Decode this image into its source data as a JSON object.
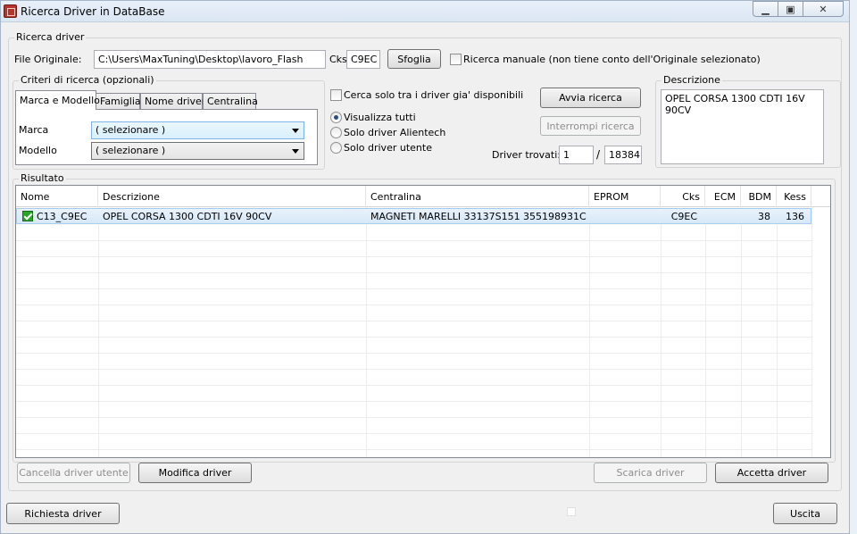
{
  "window": {
    "title": "Ricerca Driver in DataBase"
  },
  "search_group": {
    "legend": "Ricerca driver",
    "file_label": "File Originale:",
    "file_value": "C:\\Users\\MaxTuning\\Desktop\\lavoro_Flash",
    "cks_label": "Cks",
    "cks_value": "C9EC",
    "browse_label": "Sfoglia",
    "manual_label": "Ricerca manuale (non tiene conto dell'Originale selezionato)",
    "manual_checked": false
  },
  "criteria_group": {
    "legend": "Criteri di ricerca (opzionali)",
    "tabs": [
      "Marca e Modello",
      "Famiglia",
      "Nome driver",
      "Centralina"
    ],
    "active_tab": "Marca e Modello",
    "marca_label": "Marca",
    "marca_value": "( selezionare )",
    "modello_label": "Modello",
    "modello_value": "( selezionare )"
  },
  "options": {
    "only_available_label": "Cerca solo tra i driver gia' disponibili",
    "only_available_checked": false,
    "radios": [
      {
        "label": "Visualizza tutti",
        "checked": true
      },
      {
        "label": "Solo driver Alientech",
        "checked": false
      },
      {
        "label": "Solo driver utente",
        "checked": false
      }
    ],
    "start_label": "Avvia ricerca",
    "stop_label": "Interrompi ricerca",
    "found_label": "Driver trovati:",
    "found_value": "1",
    "found_sep": "/",
    "found_total": "18384"
  },
  "description_group": {
    "legend": "Descrizione",
    "text": "OPEL CORSA 1300 CDTI 16V  90CV"
  },
  "results": {
    "legend": "Risultato",
    "columns": [
      "Nome",
      "Descrizione",
      "Centralina",
      "EPROM",
      "Cks",
      "ECM",
      "BDM",
      "Kess"
    ],
    "rows": [
      {
        "nome": "C13_C9EC",
        "descrizione": "OPEL CORSA 1300 CDTI 16V  90CV",
        "centralina": "MAGNETI MARELLI 33137S151 355198931C",
        "eprom": "",
        "cks": "C9EC",
        "ecm": "",
        "bdm": "38",
        "kess": "136"
      }
    ]
  },
  "actions": {
    "delete_label": "Cancella driver utente",
    "edit_label": "Modifica driver",
    "download_label": "Scarica driver",
    "accept_label": "Accetta driver",
    "request_label": "Richiesta driver",
    "exit_label": "Uscita"
  }
}
